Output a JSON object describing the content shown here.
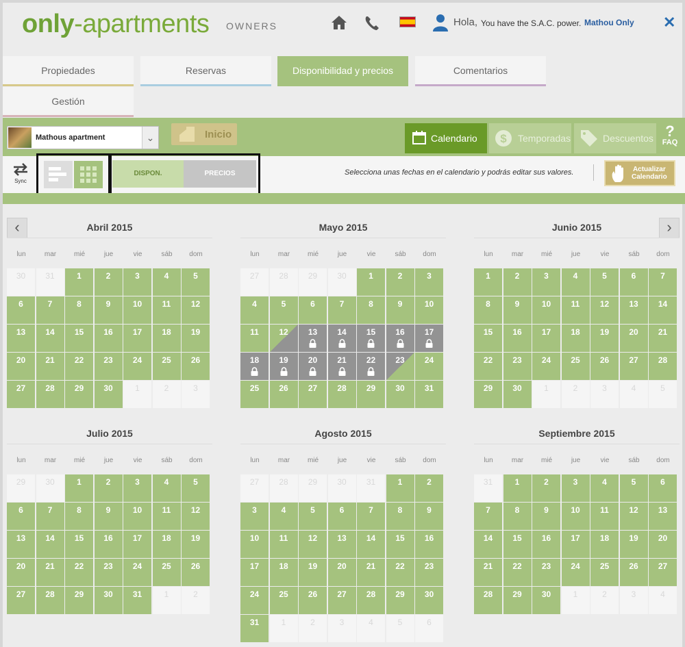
{
  "header": {
    "logo_only": "only",
    "logo_apartments": "-apartments",
    "owners": "OWNERS",
    "greeting": "Hola,",
    "sac_text": "You have the S.A.C. power.",
    "user_name": "Mathou Only",
    "icons": [
      "home-icon",
      "phone-icon",
      "spain-flag-icon",
      "user-icon",
      "close-icon"
    ]
  },
  "tabs": [
    {
      "label": "Propiedades",
      "active": false,
      "color": "#d7c98a"
    },
    {
      "label": "Reservas",
      "active": false,
      "color": "#a9cde0"
    },
    {
      "label": "Disponibilidad y precios",
      "active": true,
      "color": "#a5c27e"
    },
    {
      "label": "Comentarios",
      "active": false,
      "color": "#c5a9c9"
    },
    {
      "label": "Gestión",
      "active": false,
      "color": "#d6b3b8"
    }
  ],
  "toolbar": {
    "property": "Mathous apartment",
    "inicio": "Inicio",
    "calendario": "Calendario",
    "temporadas": "Temporadas",
    "descuentos": "Descuentos",
    "faq": "FAQ",
    "sync": "Sync",
    "dispon": "DISPON.",
    "precios": "PRECIOS",
    "instruction": "Selecciona unas fechas en el calendario y podrás editar sus valores.",
    "actualizar_1": "Actualizar",
    "actualizar_2": "Calendario"
  },
  "colors": {
    "available": "#a5c27e",
    "blocked": "#939393",
    "accent": "#6a9a28"
  },
  "weekdays": [
    "lun",
    "mar",
    "mié",
    "jue",
    "vie",
    "sáb",
    "dom"
  ],
  "months": [
    {
      "title": "Abril 2015",
      "lead": [
        "30",
        "31"
      ],
      "days": 30,
      "trail": [
        "1",
        "2",
        "3"
      ]
    },
    {
      "title": "Mayo 2015",
      "lead": [
        "27",
        "28",
        "29",
        "30"
      ],
      "days": 31,
      "trail": [],
      "blocked": [
        13,
        14,
        15,
        16,
        17,
        18,
        19,
        20,
        21,
        22
      ],
      "split_start": 12,
      "split_end": 23,
      "locked": [
        13,
        14,
        15,
        16,
        17,
        18,
        19,
        20,
        21,
        22
      ]
    },
    {
      "title": "Junio 2015",
      "lead": [],
      "days": 30,
      "trail": [
        "1",
        "2",
        "3",
        "4",
        "5"
      ]
    },
    {
      "title": "Julio 2015",
      "lead": [
        "29",
        "30"
      ],
      "days": 31,
      "trail": [
        "1",
        "2"
      ]
    },
    {
      "title": "Agosto 2015",
      "lead": [
        "27",
        "28",
        "29",
        "30",
        "31"
      ],
      "days": 31,
      "trail": [
        "1",
        "2",
        "3",
        "4",
        "5",
        "6"
      ]
    },
    {
      "title": "Septiembre 2015",
      "lead": [
        "31"
      ],
      "days": 30,
      "trail": [
        "1",
        "2",
        "3",
        "4"
      ]
    }
  ]
}
